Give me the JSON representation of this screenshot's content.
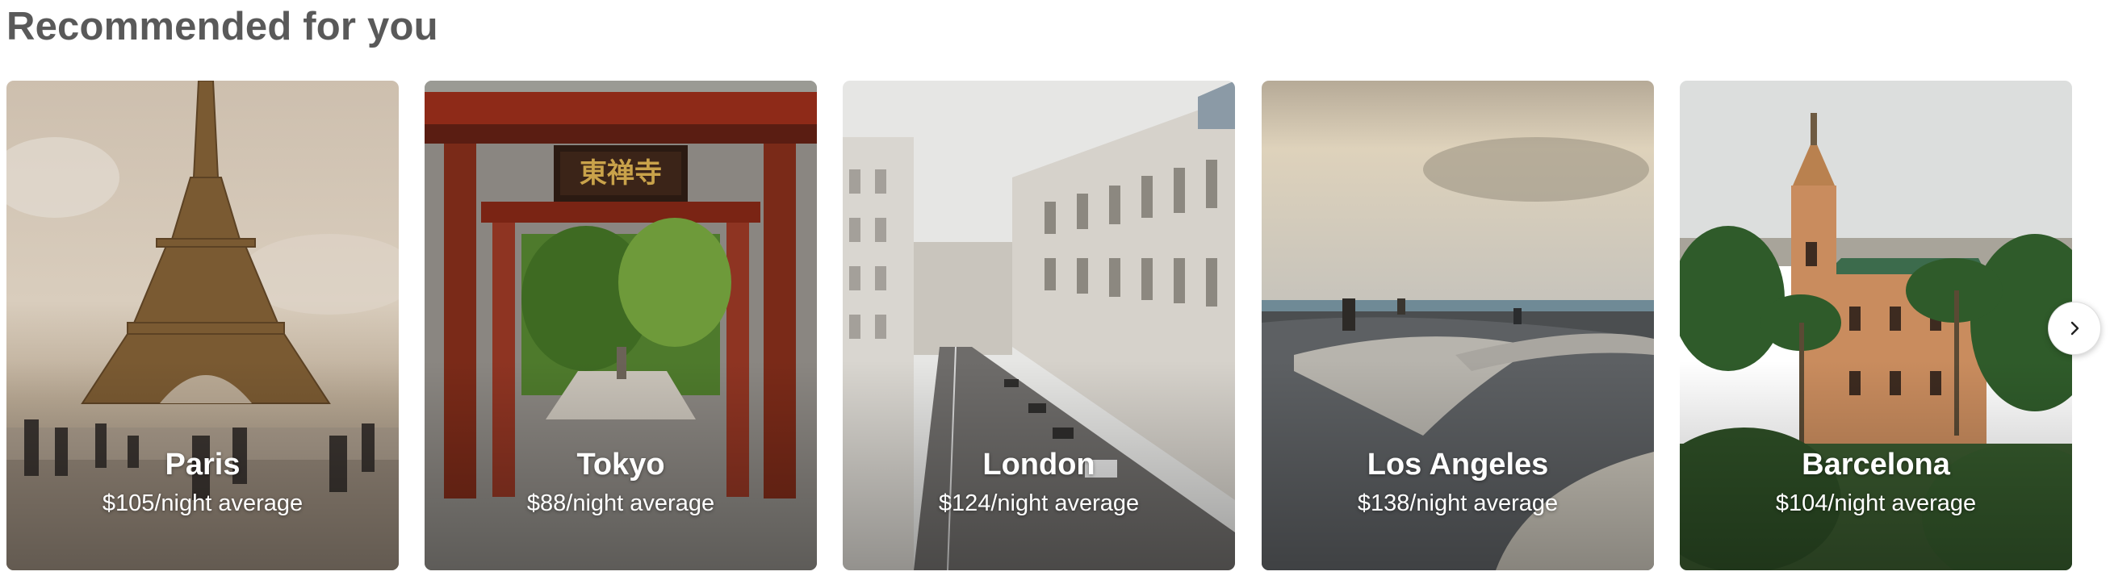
{
  "section": {
    "title": "Recommended for you"
  },
  "cards": [
    {
      "city": "Paris",
      "price": "$105/night average",
      "image": "eiffel-tower-photo"
    },
    {
      "city": "Tokyo",
      "price": "$88/night average",
      "image": "japanese-temple-gate-photo"
    },
    {
      "city": "London",
      "price": "$124/night average",
      "image": "london-street-photo"
    },
    {
      "city": "Los Angeles",
      "price": "$138/night average",
      "image": "venice-beach-skatepark-photo"
    },
    {
      "city": "Barcelona",
      "price": "$104/night average",
      "image": "barcelona-casa-vicens-photo"
    }
  ],
  "carousel": {
    "next_icon": "chevron-right-icon"
  }
}
